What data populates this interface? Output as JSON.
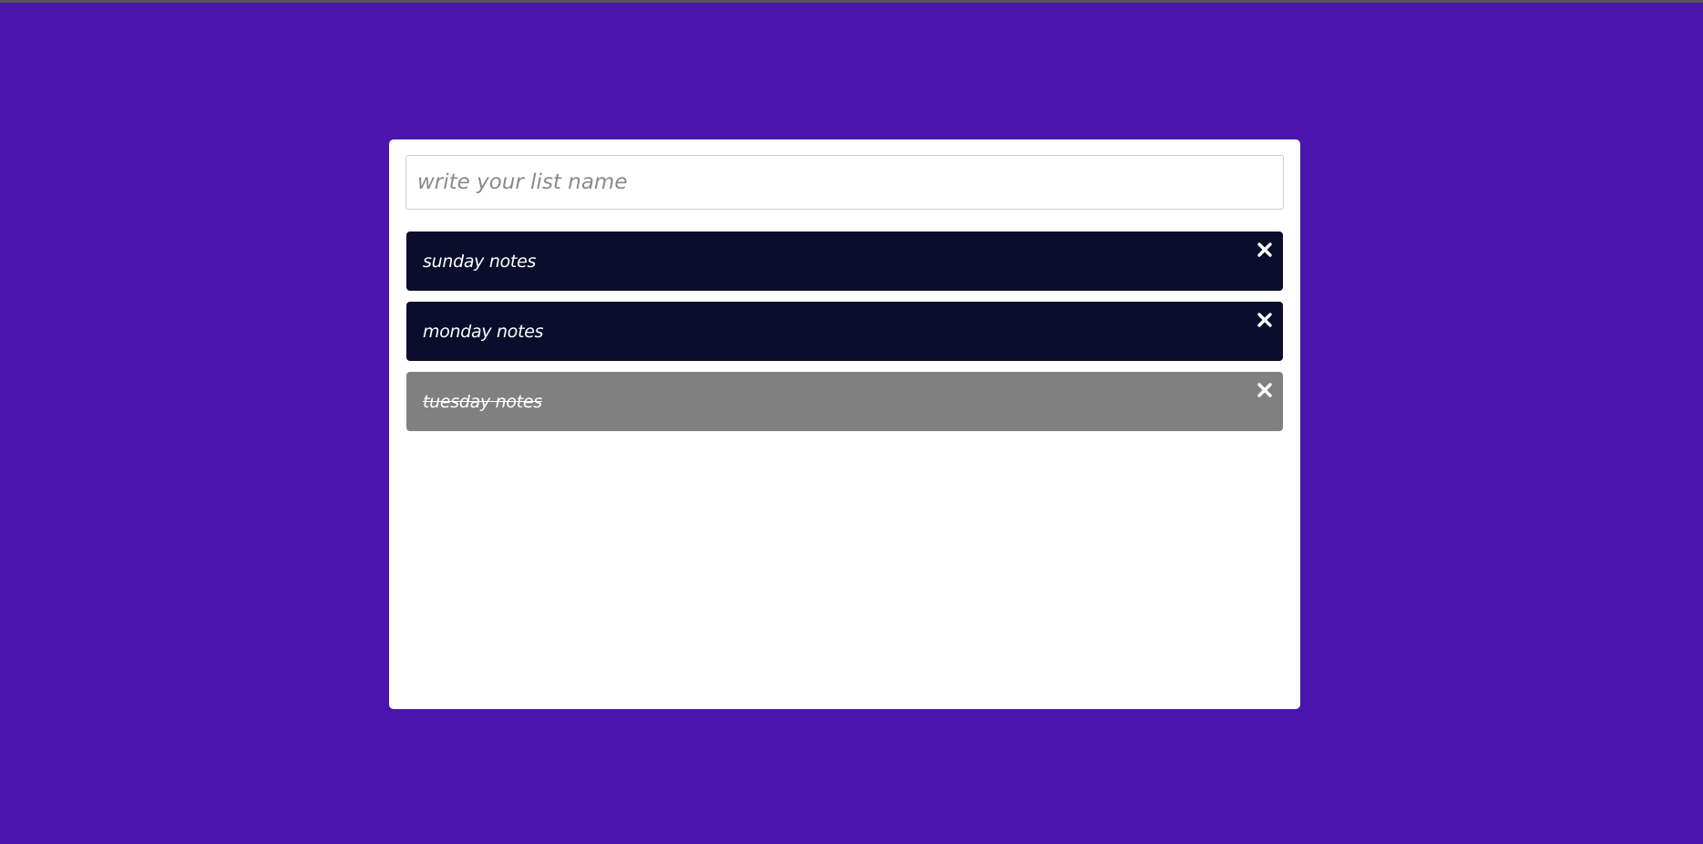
{
  "colors": {
    "background": "#4a15ad",
    "card": "#ffffff",
    "item_active": "#0a0e2c",
    "item_done": "#808080",
    "item_text": "#ffffff"
  },
  "input": {
    "placeholder": "write your list name",
    "value": ""
  },
  "lists": [
    {
      "label": "sunday notes",
      "done": false,
      "close_icon": "close-icon"
    },
    {
      "label": "monday notes",
      "done": false,
      "close_icon": "close-icon"
    },
    {
      "label": "tuesday notes",
      "done": true,
      "close_icon": "close-icon"
    }
  ]
}
